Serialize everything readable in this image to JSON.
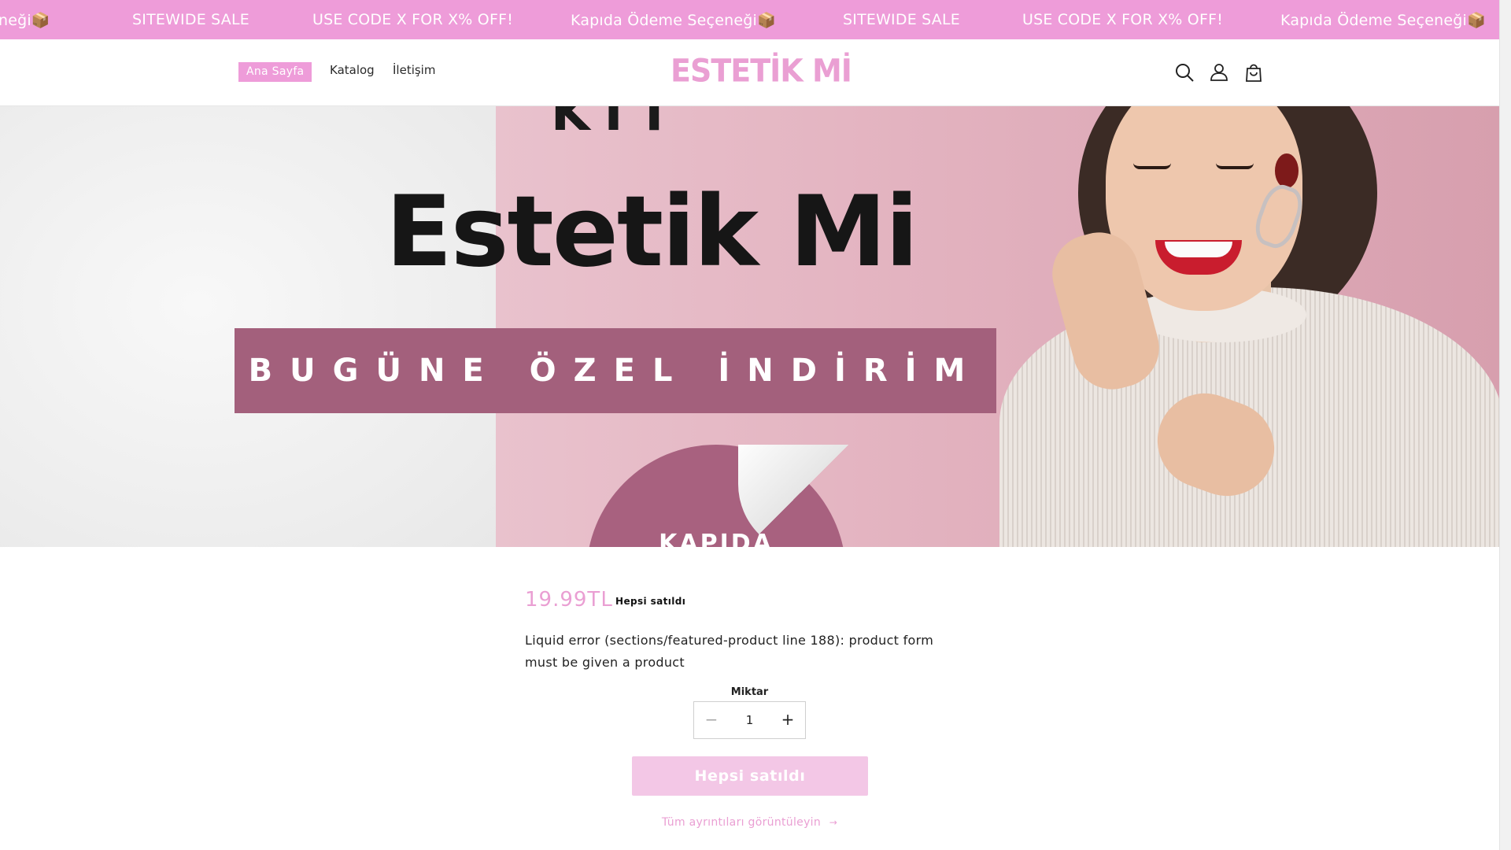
{
  "announcement": {
    "items": [
      "neği📦",
      "SITEWIDE SALE",
      "USE CODE X FOR X% OFF!",
      "Kapıda Ödeme Seçeneği📦",
      "SITEWIDE SALE",
      "USE CODE X FOR X% OFF!",
      "Kapıda Ödeme Seçeneği📦"
    ],
    "background": "#ee9cd9"
  },
  "header": {
    "nav": [
      {
        "label": "Ana Sayfa",
        "active": true
      },
      {
        "label": "Katalog",
        "active": false
      },
      {
        "label": "İletişim",
        "active": false
      }
    ],
    "logo_text": "ESTETİK Mİ",
    "icons": [
      "search-icon",
      "account-icon",
      "cart-icon"
    ]
  },
  "banner": {
    "top_word": "KIT",
    "brand": "Estetik Mi",
    "strip_text": "BUGÜNE ÖZEL İNDİRİM",
    "circle_text": "KAPIDA"
  },
  "product": {
    "price": "19.99TL",
    "badge": "Hepsi satıldı",
    "description": "Liquid error (sections/featured-product line 188): product form must be given a product",
    "quantity_label": "Miktar",
    "quantity_value": "1",
    "minus_symbol": "−",
    "plus_symbol": "+",
    "button_label": "Hepsi satıldı",
    "details_link": "Tüm ayrıntıları görüntüleyin",
    "details_arrow": "→"
  },
  "colors": {
    "accent": "#ea9fd3",
    "button_disabled": "#f3c7e6",
    "banner_strip": "#a3607c"
  }
}
